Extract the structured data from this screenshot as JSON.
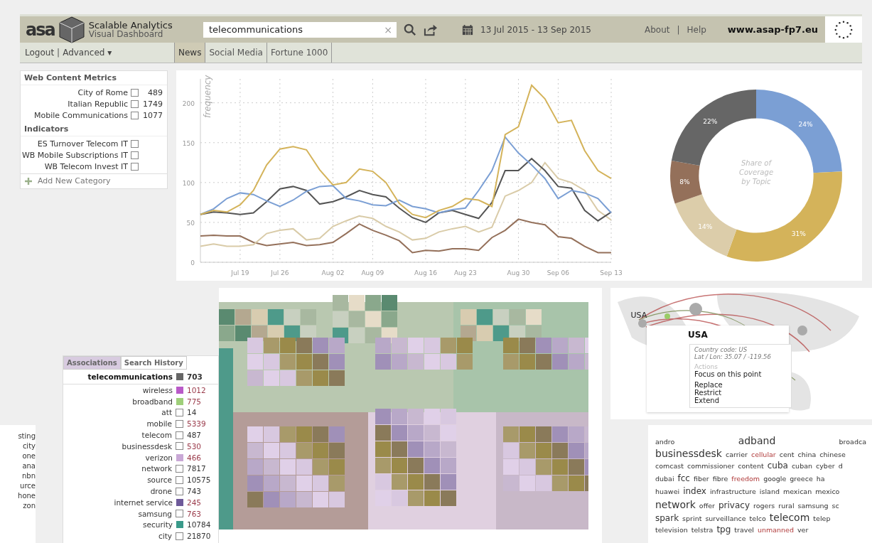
{
  "header": {
    "logo_text": "asa",
    "title": "Scalable Analytics",
    "subtitle": "Visual Dashboard",
    "search": {
      "value": "telecommunications",
      "clear": "×"
    },
    "date_range": "13 Jul 2015 - 13 Sep 2015",
    "links": [
      "About",
      "Help"
    ],
    "separator": "|",
    "site": "www.asap-fp7.eu"
  },
  "nav": {
    "links": [
      "Logout",
      "Advanced"
    ],
    "separator": "|",
    "menu_caret": "▾",
    "tabs": [
      {
        "label": "News",
        "selected": true
      },
      {
        "label": "Social Media",
        "selected": false
      },
      {
        "label": "Fortune 1000",
        "selected": false
      }
    ]
  },
  "sidebar": {
    "sections": [
      {
        "title": "Web Content Metrics",
        "items": [
          {
            "label": "City of Rome",
            "checked": false,
            "count": "489"
          },
          {
            "label": "Italian Republic",
            "checked": false,
            "count": "1749"
          },
          {
            "label": "Mobile Communications",
            "checked": false,
            "count": "1077"
          }
        ]
      },
      {
        "title": "Indicators",
        "items": [
          {
            "label": "ES Turnover Telecom IT",
            "checked": false
          },
          {
            "label": "WB Mobile Subscriptions IT",
            "checked": false
          },
          {
            "label": "WB Telecom Invest IT",
            "checked": false
          }
        ]
      }
    ],
    "add_label": "Add New Category"
  },
  "line_chart": {
    "chart_data": {
      "type": "line",
      "ylabel": "frequency",
      "categories": [
        null,
        null,
        null,
        "Jul 19",
        null,
        null,
        "Jul 26",
        null,
        null,
        null,
        "Aug 02",
        null,
        null,
        "Aug 09",
        null,
        null,
        null,
        "Aug 16",
        null,
        null,
        "Aug 23",
        null,
        null,
        null,
        "Aug 30",
        null,
        null,
        "Sep 06",
        null,
        null,
        null,
        "Sep 13"
      ],
      "ylim": [
        0,
        230
      ],
      "yticks": [
        0,
        50,
        100,
        150,
        200
      ],
      "grid": true,
      "series": [
        {
          "color": "#94705a",
          "values": [
            33,
            34,
            33,
            33,
            25,
            21,
            23,
            25,
            21,
            22,
            25,
            36,
            48,
            40,
            34,
            27,
            12,
            15,
            14,
            17,
            17,
            15,
            31,
            40,
            54,
            50,
            47,
            32,
            30,
            20,
            12,
            12
          ]
        },
        {
          "color": "#d9cba8",
          "values": [
            20,
            23,
            20,
            20,
            22,
            36,
            40,
            42,
            28,
            30,
            45,
            52,
            58,
            55,
            45,
            38,
            28,
            30,
            38,
            42,
            45,
            38,
            44,
            83,
            90,
            100,
            125,
            105,
            100,
            90,
            65,
            53
          ]
        },
        {
          "color": "#555555",
          "values": [
            60,
            63,
            62,
            60,
            62,
            76,
            92,
            95,
            90,
            73,
            76,
            82,
            90,
            85,
            82,
            68,
            56,
            50,
            62,
            65,
            60,
            55,
            75,
            115,
            115,
            130,
            115,
            95,
            93,
            65,
            52,
            63
          ]
        },
        {
          "color": "#7b9fd4",
          "values": [
            60,
            67,
            80,
            87,
            85,
            77,
            70,
            78,
            89,
            95,
            96,
            80,
            77,
            72,
            71,
            78,
            70,
            67,
            62,
            66,
            68,
            90,
            115,
            157,
            137,
            122,
            105,
            80,
            90,
            87,
            80,
            62
          ]
        },
        {
          "color": "#d4b35a",
          "values": [
            60,
            65,
            63,
            72,
            90,
            122,
            142,
            145,
            141,
            116,
            97,
            100,
            117,
            114,
            100,
            74,
            60,
            56,
            65,
            70,
            80,
            78,
            70,
            160,
            170,
            222,
            205,
            175,
            178,
            140,
            115,
            105
          ]
        }
      ]
    }
  },
  "donut": {
    "chart_data": {
      "type": "donut",
      "title": "Share of Coverage by Topic",
      "data_labels": true,
      "values": [
        24,
        31,
        14,
        8,
        22
      ],
      "colors": [
        "#7b9fd4",
        "#d4b35a",
        "#dccdaa",
        "#94705a",
        "#666666"
      ],
      "value_labels": [
        "24%",
        "31%",
        "14%",
        "8%",
        "22%"
      ]
    }
  },
  "clipped_list": [
    "sting",
    "city",
    "one",
    "ana",
    "nbn",
    "urce",
    "hone",
    "zon"
  ],
  "associations": {
    "tabs": [
      {
        "label": "Associations",
        "selected": true
      },
      {
        "label": "Search History",
        "selected": false
      }
    ],
    "rows": [
      {
        "term": "telecommunications",
        "color": "#666666",
        "count": "703",
        "highlighted": false,
        "main": true
      },
      {
        "term": "wireless",
        "color": "#b95ac8",
        "count": "1012",
        "highlighted": true,
        "main": false
      },
      {
        "term": "broadband",
        "color": "#9fcf7a",
        "count": "775",
        "highlighted": true,
        "main": false
      },
      {
        "term": "att",
        "checked": false,
        "count": "14",
        "highlighted": false,
        "main": false
      },
      {
        "term": "mobile",
        "checked": false,
        "count": "5339",
        "highlighted": true,
        "main": false
      },
      {
        "term": "telecom",
        "checked": false,
        "count": "487",
        "highlighted": false,
        "main": false
      },
      {
        "term": "businessdesk",
        "checked": false,
        "count": "530",
        "highlighted": true,
        "main": false
      },
      {
        "term": "verizon",
        "color": "#c9a8d6",
        "count": "466",
        "highlighted": true,
        "main": false
      },
      {
        "term": "network",
        "checked": false,
        "count": "7817",
        "highlighted": false,
        "main": false
      },
      {
        "term": "source",
        "checked": false,
        "count": "10575",
        "highlighted": false,
        "main": false
      },
      {
        "term": "drone",
        "checked": false,
        "count": "743",
        "highlighted": false,
        "main": false
      },
      {
        "term": "internet service",
        "color": "#6e5a9a",
        "count": "245",
        "highlighted": true,
        "main": false
      },
      {
        "term": "samsung",
        "checked": false,
        "count": "763",
        "highlighted": true,
        "main": false
      },
      {
        "term": "security",
        "color": "#3a9a8a",
        "count": "10784",
        "highlighted": false,
        "main": false
      },
      {
        "term": "city",
        "checked": false,
        "count": "21870",
        "highlighted": false,
        "main": false
      }
    ]
  },
  "map": {
    "label": "USA"
  },
  "popup": {
    "title": "USA",
    "details": [
      "Country code: US",
      "Lat / Lon: 35.07 / -119.56"
    ],
    "actions_title": "Actions",
    "actions": [
      "Focus on this point",
      "Replace",
      "Restrict",
      "Extend"
    ]
  },
  "word_cloud": {
    "lines": [
      [
        {
          "text": "andro",
          "kind": "small",
          "highlighted": false
        },
        {
          "text": "adband",
          "kind": "large",
          "highlighted": false
        },
        {
          "text": "broadca",
          "kind": "small",
          "highlighted": false
        }
      ],
      [
        {
          "text": "businessdesk",
          "kind": "large",
          "highlighted": false
        },
        {
          "text": "carrier",
          "kind": "small",
          "highlighted": false
        },
        {
          "text": "cellular",
          "kind": "small",
          "highlighted": true
        },
        {
          "text": "cent",
          "kind": "small",
          "highlighted": false
        },
        {
          "text": "china",
          "kind": "small",
          "highlighted": false
        },
        {
          "text": "chinese",
          "kind": "small",
          "highlighted": false
        }
      ],
      [
        {
          "text": "comcast",
          "kind": "small",
          "highlighted": false
        },
        {
          "text": "commissioner",
          "kind": "small",
          "highlighted": false
        },
        {
          "text": "content",
          "kind": "small",
          "highlighted": false
        },
        {
          "text": "cuba",
          "kind": "medium",
          "highlighted": false
        },
        {
          "text": "cuban",
          "kind": "small",
          "highlighted": false
        },
        {
          "text": "cyber",
          "kind": "small",
          "highlighted": false
        },
        {
          "text": "d",
          "kind": "small",
          "highlighted": false
        }
      ],
      [
        {
          "text": "dubai",
          "kind": "small",
          "highlighted": false
        },
        {
          "text": "fcc",
          "kind": "medium",
          "highlighted": false
        },
        {
          "text": "fiber",
          "kind": "small",
          "highlighted": false
        },
        {
          "text": "fibre",
          "kind": "small",
          "highlighted": false
        },
        {
          "text": "freedom",
          "kind": "small",
          "highlighted": true
        },
        {
          "text": "google",
          "kind": "small",
          "highlighted": false
        },
        {
          "text": "greece",
          "kind": "small",
          "highlighted": false
        },
        {
          "text": "ha",
          "kind": "small",
          "highlighted": false
        }
      ],
      [
        {
          "text": "huawei",
          "kind": "small",
          "highlighted": false
        },
        {
          "text": "index",
          "kind": "medium",
          "highlighted": false
        },
        {
          "text": "infrastructure",
          "kind": "small",
          "highlighted": false
        },
        {
          "text": "island",
          "kind": "small",
          "highlighted": false
        },
        {
          "text": "mexican",
          "kind": "small",
          "highlighted": false
        },
        {
          "text": "mexico",
          "kind": "small",
          "highlighted": false
        }
      ],
      [
        {
          "text": "network",
          "kind": "large",
          "highlighted": false
        },
        {
          "text": "offer",
          "kind": "small",
          "highlighted": false
        },
        {
          "text": "privacy",
          "kind": "medium",
          "highlighted": false
        },
        {
          "text": "rogers",
          "kind": "small",
          "highlighted": false
        },
        {
          "text": "rural",
          "kind": "small",
          "highlighted": false
        },
        {
          "text": "samsung",
          "kind": "small",
          "highlighted": false
        },
        {
          "text": "sc",
          "kind": "small",
          "highlighted": false
        }
      ],
      [
        {
          "text": "spark",
          "kind": "medium",
          "highlighted": false
        },
        {
          "text": "sprint",
          "kind": "small",
          "highlighted": false
        },
        {
          "text": "surveillance",
          "kind": "small",
          "highlighted": false
        },
        {
          "text": "telco",
          "kind": "small",
          "highlighted": false
        },
        {
          "text": "telecom",
          "kind": "large",
          "highlighted": false
        },
        {
          "text": "telep",
          "kind": "small",
          "highlighted": false
        }
      ],
      [
        {
          "text": "television",
          "kind": "small",
          "highlighted": false
        },
        {
          "text": "telstra",
          "kind": "small",
          "highlighted": false
        },
        {
          "text": "tpg",
          "kind": "medium",
          "highlighted": false
        },
        {
          "text": "travel",
          "kind": "small",
          "highlighted": false
        },
        {
          "text": "unmanned",
          "kind": "small",
          "highlighted": true
        },
        {
          "text": "ver",
          "kind": "small",
          "highlighted": false
        }
      ]
    ]
  }
}
